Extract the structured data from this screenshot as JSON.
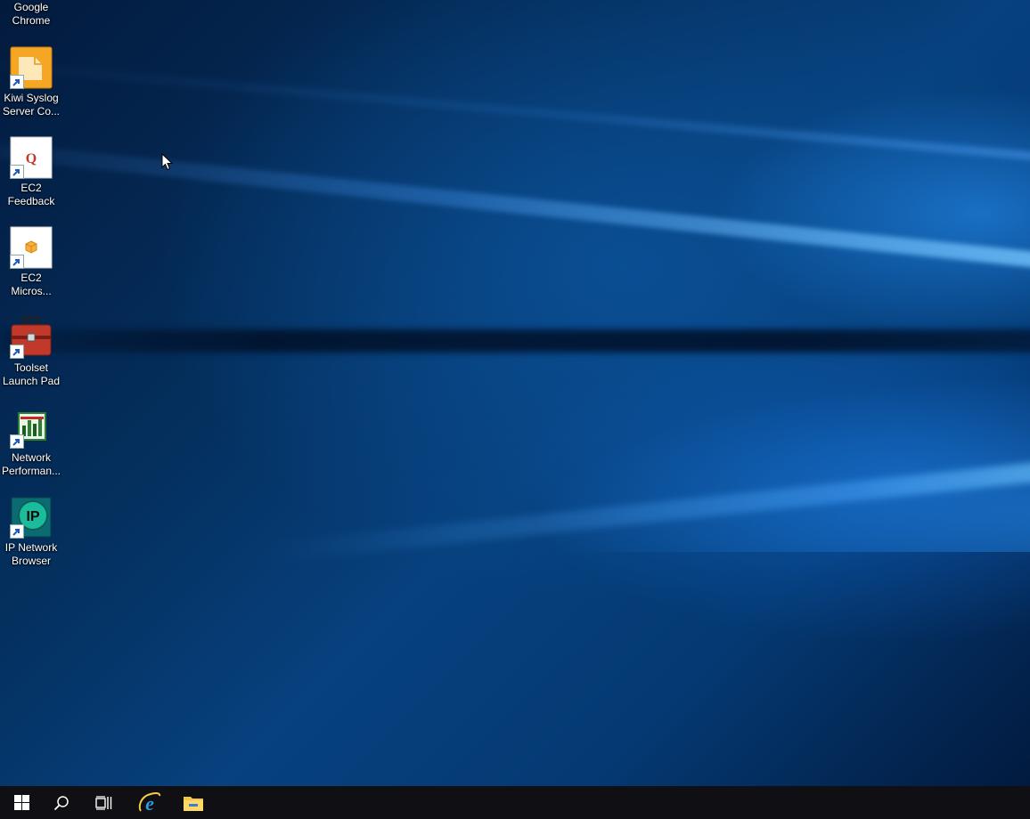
{
  "desktop": {
    "icons": [
      {
        "label_line1": "Google",
        "label_line2": "Chrome",
        "icon": "chrome-icon"
      },
      {
        "label_line1": "Kiwi Syslog",
        "label_line2": "Server Co...",
        "icon": "kiwi-syslog-icon"
      },
      {
        "label_line1": "EC2",
        "label_line2": "Feedback",
        "icon": "ec2-feedback-icon"
      },
      {
        "label_line1": "EC2",
        "label_line2": "Micros...",
        "icon": "ec2-microsoft-icon"
      },
      {
        "label_line1": "Toolset",
        "label_line2": "Launch Pad",
        "icon": "toolbox-icon"
      },
      {
        "label_line1": "Network",
        "label_line2": "Performan...",
        "icon": "network-performance-icon"
      },
      {
        "label_line1": "IP Network",
        "label_line2": "Browser",
        "icon": "ip-network-browser-icon"
      }
    ]
  },
  "taskbar": {
    "buttons": [
      {
        "name": "start",
        "icon": "windows-logo-icon"
      },
      {
        "name": "search",
        "icon": "search-icon"
      },
      {
        "name": "task-view",
        "icon": "task-view-icon"
      },
      {
        "name": "internet-explorer",
        "icon": "internet-explorer-icon"
      },
      {
        "name": "file-explorer",
        "icon": "folder-icon"
      }
    ]
  },
  "colors": {
    "taskbar_bg": "#0f0f14",
    "desktop_accent": "#0a4e93"
  }
}
